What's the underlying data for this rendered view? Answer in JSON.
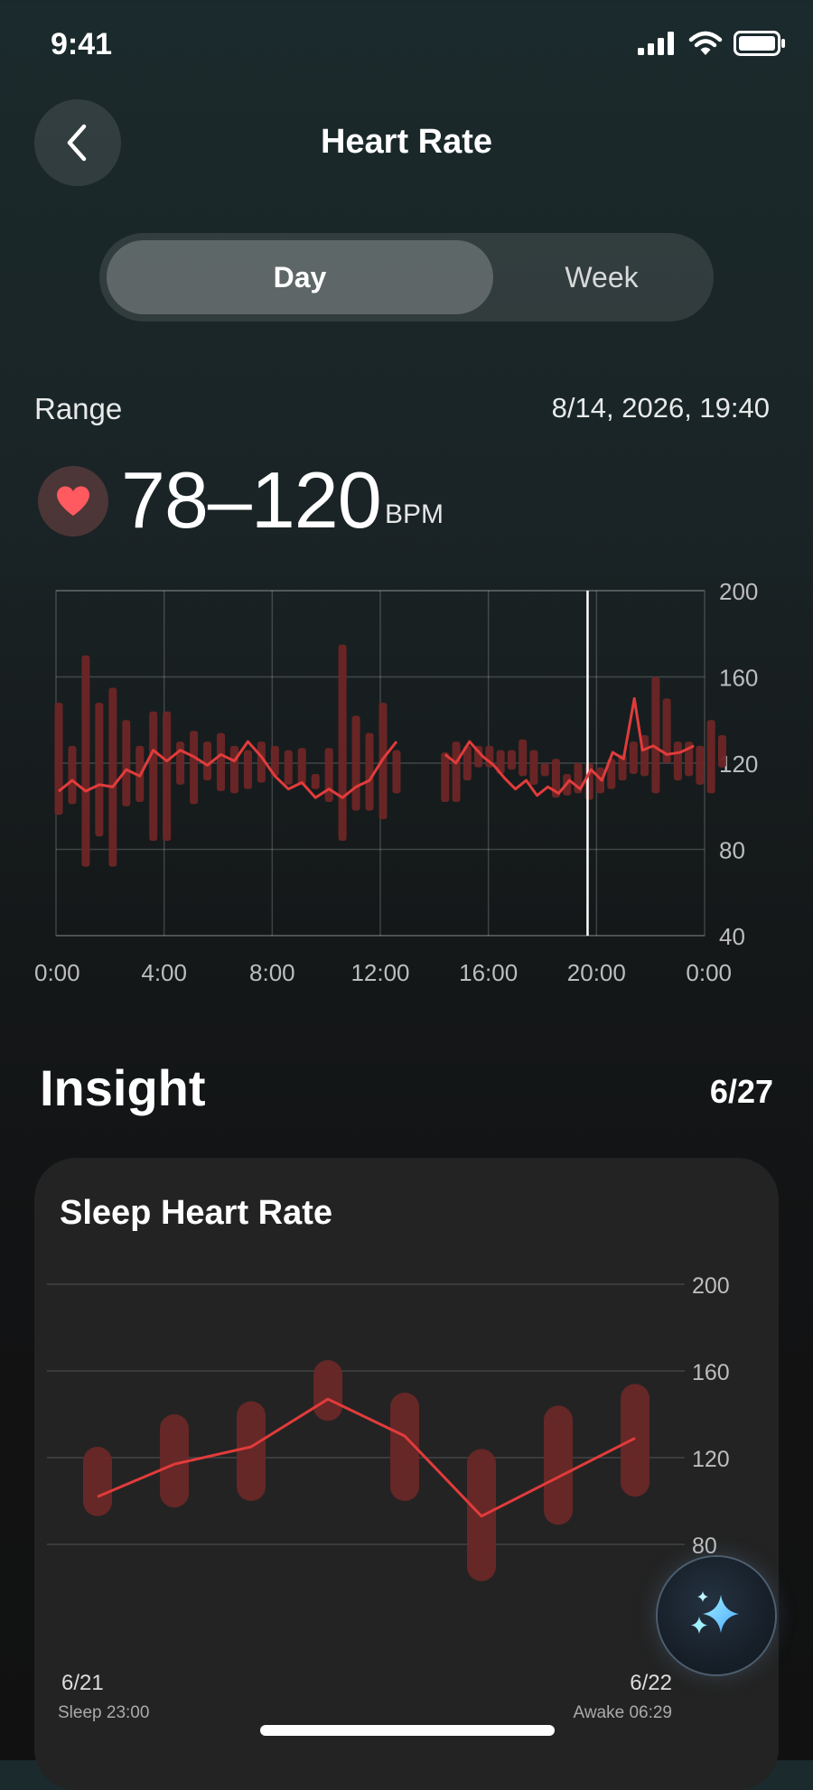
{
  "status": {
    "time": "9:41"
  },
  "header": {
    "title": "Heart Rate",
    "back_icon": "chevron-left-icon"
  },
  "segmented": {
    "day": "Day",
    "week": "Week",
    "selected": "Day"
  },
  "summary": {
    "label": "Range",
    "datetime": "8/14, 2026, 19:40",
    "value": "78–120",
    "unit": "BPM",
    "icon": "heart-icon"
  },
  "insight": {
    "title": "Insight",
    "count": "6/27",
    "card": {
      "title": "Sleep Heart Rate",
      "start_date": "6/21",
      "end_date": "6/22",
      "sleep_label": "Sleep 23:00",
      "awake_label": "Awake 06:29"
    }
  },
  "colors": {
    "accent": "#e03a3a",
    "bar": "#7a2a2a",
    "background": "#15191a",
    "card": "#232323"
  },
  "chart_data": [
    {
      "type": "bar",
      "ylim": [
        40,
        200
      ],
      "yticks": [
        "200",
        "160",
        "120",
        "80",
        "40"
      ],
      "xticks": [
        "0:00",
        "4:00",
        "8:00",
        "12:00",
        "16:00",
        "20:00",
        "0:00"
      ],
      "grid": true,
      "legend": "none",
      "ranges": [
        [
          96,
          148
        ],
        [
          101,
          128
        ],
        [
          72,
          170
        ],
        [
          86,
          148
        ],
        [
          72,
          155
        ],
        [
          100,
          140
        ],
        [
          102,
          128
        ],
        [
          84,
          144
        ],
        [
          84,
          144
        ],
        [
          110,
          130
        ],
        [
          101,
          135
        ],
        [
          112,
          130
        ],
        [
          107,
          134
        ],
        [
          106,
          128
        ],
        [
          108,
          126
        ],
        [
          111,
          130
        ],
        [
          114,
          128
        ],
        [
          110,
          126
        ],
        [
          110,
          127
        ],
        [
          108,
          115
        ],
        [
          102,
          127
        ],
        [
          84,
          175
        ],
        [
          98,
          142
        ],
        [
          98,
          134
        ],
        [
          94,
          148
        ],
        [
          106,
          126
        ],
        [
          102,
          125
        ],
        [
          102,
          130
        ],
        [
          112,
          128
        ],
        [
          118,
          128
        ],
        [
          118,
          128
        ],
        [
          115,
          126
        ],
        [
          117,
          126
        ],
        [
          114,
          131
        ],
        [
          110,
          126
        ],
        [
          114,
          120
        ],
        [
          104,
          122
        ],
        [
          105,
          115
        ],
        [
          106,
          120
        ],
        [
          103,
          120
        ],
        [
          106,
          118
        ],
        [
          108,
          122
        ],
        [
          112,
          124
        ],
        [
          115,
          130
        ],
        [
          114,
          133
        ],
        [
          106,
          160
        ],
        [
          120,
          150
        ],
        [
          112,
          130
        ],
        [
          114,
          130
        ],
        [
          110,
          128
        ],
        [
          106,
          140
        ],
        [
          118,
          133
        ]
      ],
      "line": [
        [
          0.1,
          107
        ],
        [
          0.6,
          112
        ],
        [
          1.1,
          107
        ],
        [
          1.6,
          110
        ],
        [
          2.1,
          109
        ],
        [
          2.6,
          117
        ],
        [
          3.1,
          114
        ],
        [
          3.6,
          126
        ],
        [
          4.1,
          121
        ],
        [
          4.6,
          126
        ],
        [
          5.1,
          123
        ],
        [
          5.6,
          119
        ],
        [
          6.1,
          124
        ],
        [
          6.6,
          121
        ],
        [
          7.1,
          130
        ],
        [
          7.6,
          123
        ],
        [
          8.1,
          114
        ],
        [
          8.6,
          108
        ],
        [
          9.1,
          111
        ],
        [
          9.6,
          104
        ],
        [
          10.1,
          108
        ],
        [
          10.6,
          104
        ],
        [
          11.1,
          109
        ],
        [
          11.6,
          112
        ],
        [
          12.1,
          122
        ],
        [
          12.6,
          130
        ],
        null,
        [
          14.4,
          124
        ],
        [
          14.8,
          120
        ],
        [
          15.3,
          130
        ],
        [
          15.8,
          123
        ],
        [
          16.2,
          119
        ],
        [
          16.6,
          113
        ],
        [
          17.0,
          108
        ],
        [
          17.4,
          112
        ],
        [
          17.8,
          105
        ],
        [
          18.2,
          109
        ],
        [
          18.6,
          106
        ],
        [
          19.0,
          112
        ],
        [
          19.4,
          108
        ],
        [
          19.8,
          117
        ],
        [
          20.2,
          112
        ],
        [
          20.6,
          125
        ],
        [
          21.0,
          122
        ],
        [
          21.4,
          150
        ],
        [
          21.7,
          126
        ],
        [
          22.1,
          128
        ],
        [
          22.6,
          124
        ],
        [
          23.1,
          125
        ],
        [
          23.6,
          128
        ]
      ]
    },
    {
      "type": "line",
      "title": "Sleep Heart Rate",
      "ylim": [
        40,
        200
      ],
      "yticks": [
        "200",
        "160",
        "120",
        "80"
      ],
      "categories": [
        "6/21",
        "6/22"
      ],
      "ranges": [
        [
          93,
          125
        ],
        [
          97,
          140
        ],
        [
          100,
          146
        ],
        [
          137,
          165
        ],
        [
          100,
          150
        ],
        [
          63,
          124
        ],
        [
          89,
          144
        ],
        [
          102,
          154
        ]
      ],
      "line": [
        102,
        117,
        125,
        147,
        130,
        93,
        111,
        129
      ]
    }
  ]
}
